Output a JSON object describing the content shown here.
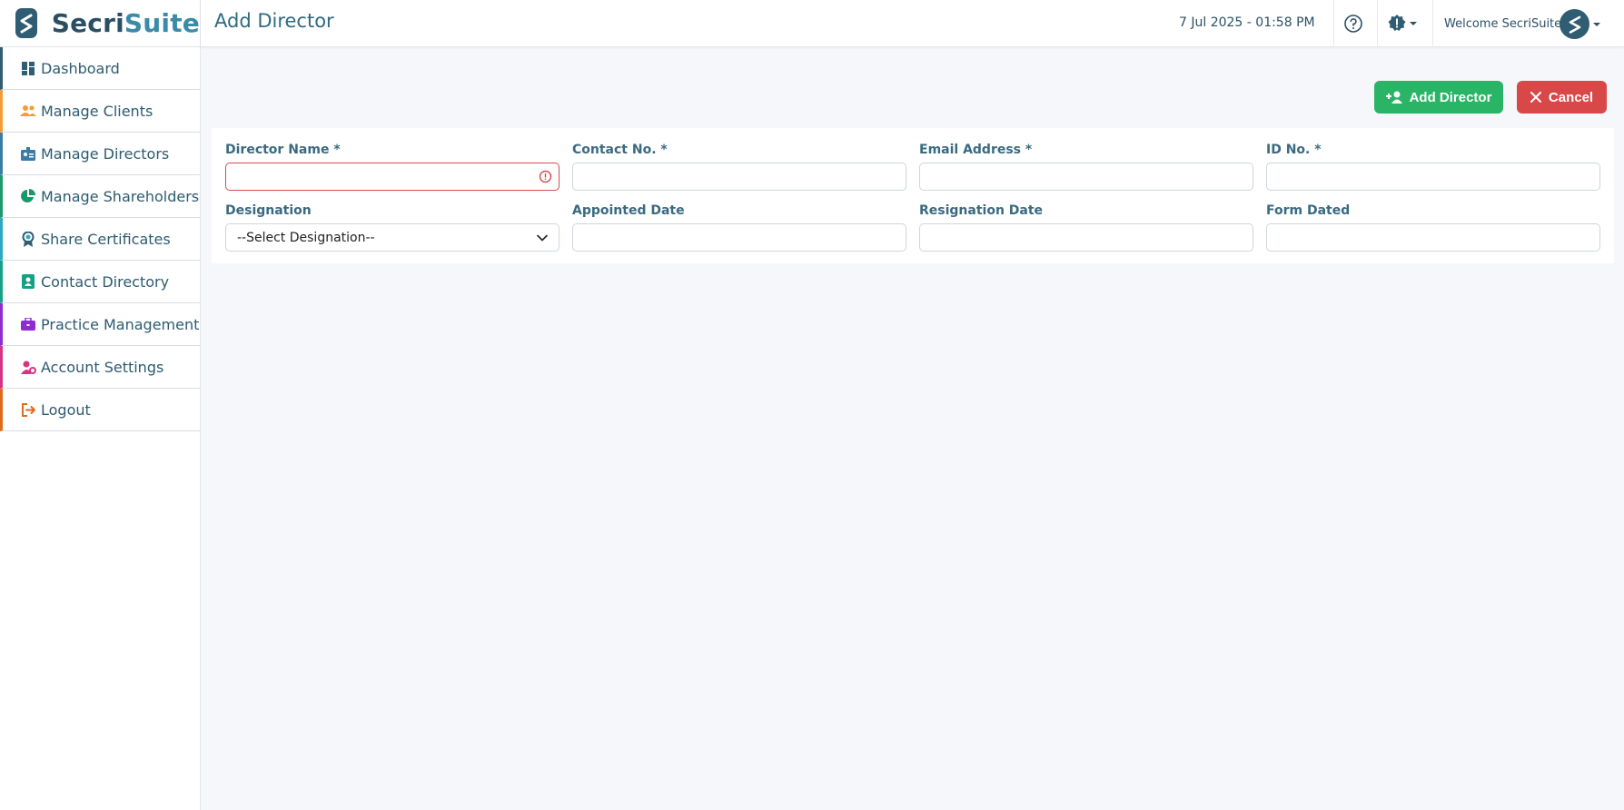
{
  "brand": {
    "part1": "Secri",
    "part2": "Suite"
  },
  "sidebar": {
    "items": [
      {
        "label": "Dashboard",
        "icon": "dashboard-icon",
        "color": "#2f5d73"
      },
      {
        "label": "Manage Clients",
        "icon": "users-icon",
        "color": "#f39c34"
      },
      {
        "label": "Manage Directors",
        "icon": "id-badge-icon",
        "color": "#3a7ca5"
      },
      {
        "label": "Manage Shareholders",
        "icon": "pie-chart-icon",
        "color": "#1a9a6a"
      },
      {
        "label": "Share Certificates",
        "icon": "award-icon",
        "color": "#2fa8c2"
      },
      {
        "label": "Contact Directory",
        "icon": "contact-book-icon",
        "color": "#16a085"
      },
      {
        "label": "Practice Management",
        "icon": "briefcase-icon",
        "color": "#8e2bd1"
      },
      {
        "label": "Account Settings",
        "icon": "user-gear-icon",
        "color": "#d63384"
      },
      {
        "label": "Logout",
        "icon": "logout-icon",
        "color": "#e06a1b"
      }
    ]
  },
  "header": {
    "title": "Add Director",
    "datetime": "7 Jul 2025 - 01:58 PM",
    "welcome": "Welcome SecriSuite"
  },
  "actions": {
    "add_label": "Add Director",
    "cancel_label": "Cancel"
  },
  "form": {
    "director_name": {
      "label": "Director Name *",
      "value": ""
    },
    "contact_no": {
      "label": "Contact No. *",
      "value": ""
    },
    "email": {
      "label": "Email Address *",
      "value": ""
    },
    "id_no": {
      "label": "ID No. *",
      "value": ""
    },
    "designation": {
      "label": "Designation",
      "selected": "--Select Designation--"
    },
    "appointed_date": {
      "label": "Appointed Date",
      "value": ""
    },
    "resignation_date": {
      "label": "Resignation Date",
      "value": ""
    },
    "form_dated": {
      "label": "Form Dated",
      "value": ""
    }
  },
  "colors": {
    "primary": "#2f5d73",
    "success": "#2ab466",
    "danger": "#d94848"
  }
}
